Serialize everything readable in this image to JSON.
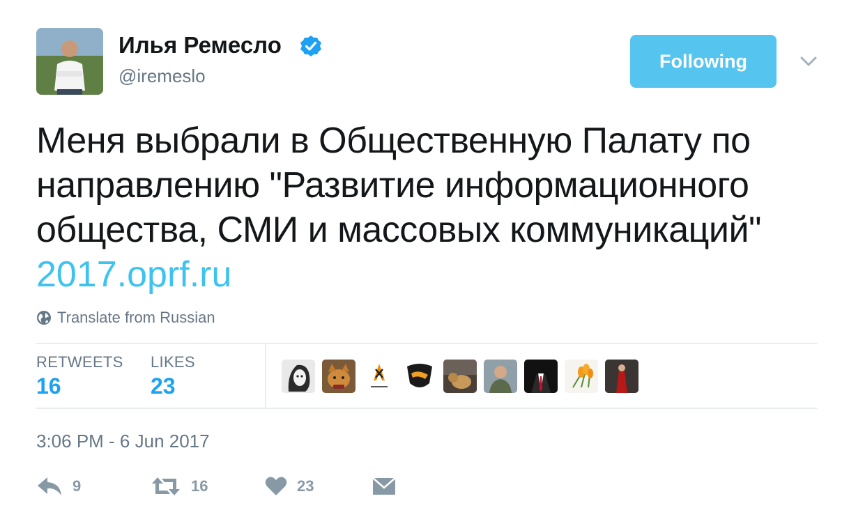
{
  "author": {
    "name": "Илья Ремесло",
    "handle": "@iremeslo",
    "verified": true
  },
  "follow_button": {
    "label": "Following"
  },
  "tweet": {
    "text": "Меня выбрали в Общественную Палату по\nнаправлению \"Развитие информационного\nобщества, СМИ и массовых коммуникаций\"",
    "link": "2017.oprf.ru"
  },
  "translate": {
    "label": "Translate from Russian"
  },
  "stats": {
    "retweets_label": "RETWEETS",
    "retweets_value": "16",
    "likes_label": "LIKES",
    "likes_value": "23"
  },
  "timestamp": "3:06 PM - 6 Jun 2017",
  "actions": {
    "reply_count": "9",
    "retweet_count": "16",
    "like_count": "23"
  },
  "colors": {
    "accent": "#1da1f2",
    "link": "#3ec3f0",
    "follow_button": "#55c4ee",
    "muted": "#657786",
    "action_icon": "#8899a6"
  },
  "icons": {
    "verified": "verified-badge-icon",
    "caret": "chevron-down-icon",
    "globe": "globe-icon",
    "reply": "reply-icon",
    "retweet": "retweet-icon",
    "like": "heart-icon",
    "message": "envelope-icon"
  }
}
